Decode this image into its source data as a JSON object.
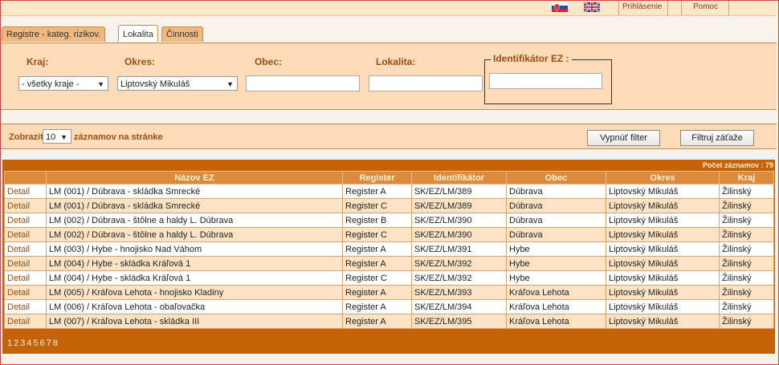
{
  "topbar": {
    "login": "Prihlásenie",
    "help": "Pomoc"
  },
  "tabs": [
    "Registre - kateg. rizikov.",
    "Lokalita",
    "Činnosti"
  ],
  "filter": {
    "kraj_label": "Kraj:",
    "kraj_value": "- všetky kraje -",
    "okres_label": "Okres:",
    "okres_value": "Liptovský Mikuláš",
    "obec_label": "Obec:",
    "lokalita_label": "Lokalita:",
    "identifikator_label": "Identifikátor EZ :"
  },
  "controls": {
    "show_label": "Zobraziť",
    "page_size": "10",
    "per_page_label": "záznamov na stránke",
    "reset_button": "Vypnúť filter",
    "filter_button": "Filtruj záťaže"
  },
  "table": {
    "count_label": "Počet záznamov : 79",
    "headers": [
      "",
      "Názov EZ",
      "Register",
      "Identifikátor",
      "Obec",
      "Okres",
      "Kraj"
    ],
    "rows": [
      [
        "Detail",
        "LM (001) / Dúbrava - skládka Smrecké",
        "Register A",
        "SK/EZ/LM/389",
        "Dúbrava",
        "Liptovský Mikuláš",
        "Žilinský"
      ],
      [
        "Detail",
        "LM (001) / Dúbrava - skládka Smrecké",
        "Register C",
        "SK/EZ/LM/389",
        "Dúbrava",
        "Liptovský Mikuláš",
        "Žilinský"
      ],
      [
        "Detail",
        "LM (002) / Dúbrava - štôlne a haldy L. Dúbrava",
        "Register B",
        "SK/EZ/LM/390",
        "Dúbrava",
        "Liptovský Mikuláš",
        "Žilinský"
      ],
      [
        "Detail",
        "LM (002) / Dúbrava - štôlne a haldy L. Dúbrava",
        "Register C",
        "SK/EZ/LM/390",
        "Dúbrava",
        "Liptovský Mikuláš",
        "Žilinský"
      ],
      [
        "Detail",
        "LM (003) / Hybe - hnojisko Nad Váhom",
        "Register A",
        "SK/EZ/LM/391",
        "Hybe",
        "Liptovský Mikuláš",
        "Žilinský"
      ],
      [
        "Detail",
        "LM (004) / Hybe - skládka Kráľová 1",
        "Register A",
        "SK/EZ/LM/392",
        "Hybe",
        "Liptovský Mikuláš",
        "Žilinský"
      ],
      [
        "Detail",
        "LM (004) / Hybe - skládka Kráľová 1",
        "Register C",
        "SK/EZ/LM/392",
        "Hybe",
        "Liptovský Mikuláš",
        "Žilinský"
      ],
      [
        "Detail",
        "LM (005) / Kráľova Lehota - hnojisko Kladiny",
        "Register A",
        "SK/EZ/LM/393",
        "Kráľova Lehota",
        "Liptovský Mikuláš",
        "Žilinský"
      ],
      [
        "Detail",
        "LM (006) / Kráľova Lehota - obaľovačka",
        "Register A",
        "SK/EZ/LM/394",
        "Kráľova Lehota",
        "Liptovský Mikuláš",
        "Žilinský"
      ],
      [
        "Detail",
        "LM (007) / Kráľova Lehota - skládka III",
        "Register A",
        "SK/EZ/LM/395",
        "Kráľova Lehota",
        "Liptovský Mikuláš",
        "Žilinský"
      ]
    ],
    "pages": [
      "1",
      "2",
      "3",
      "4",
      "5",
      "6",
      "7",
      "8"
    ]
  }
}
